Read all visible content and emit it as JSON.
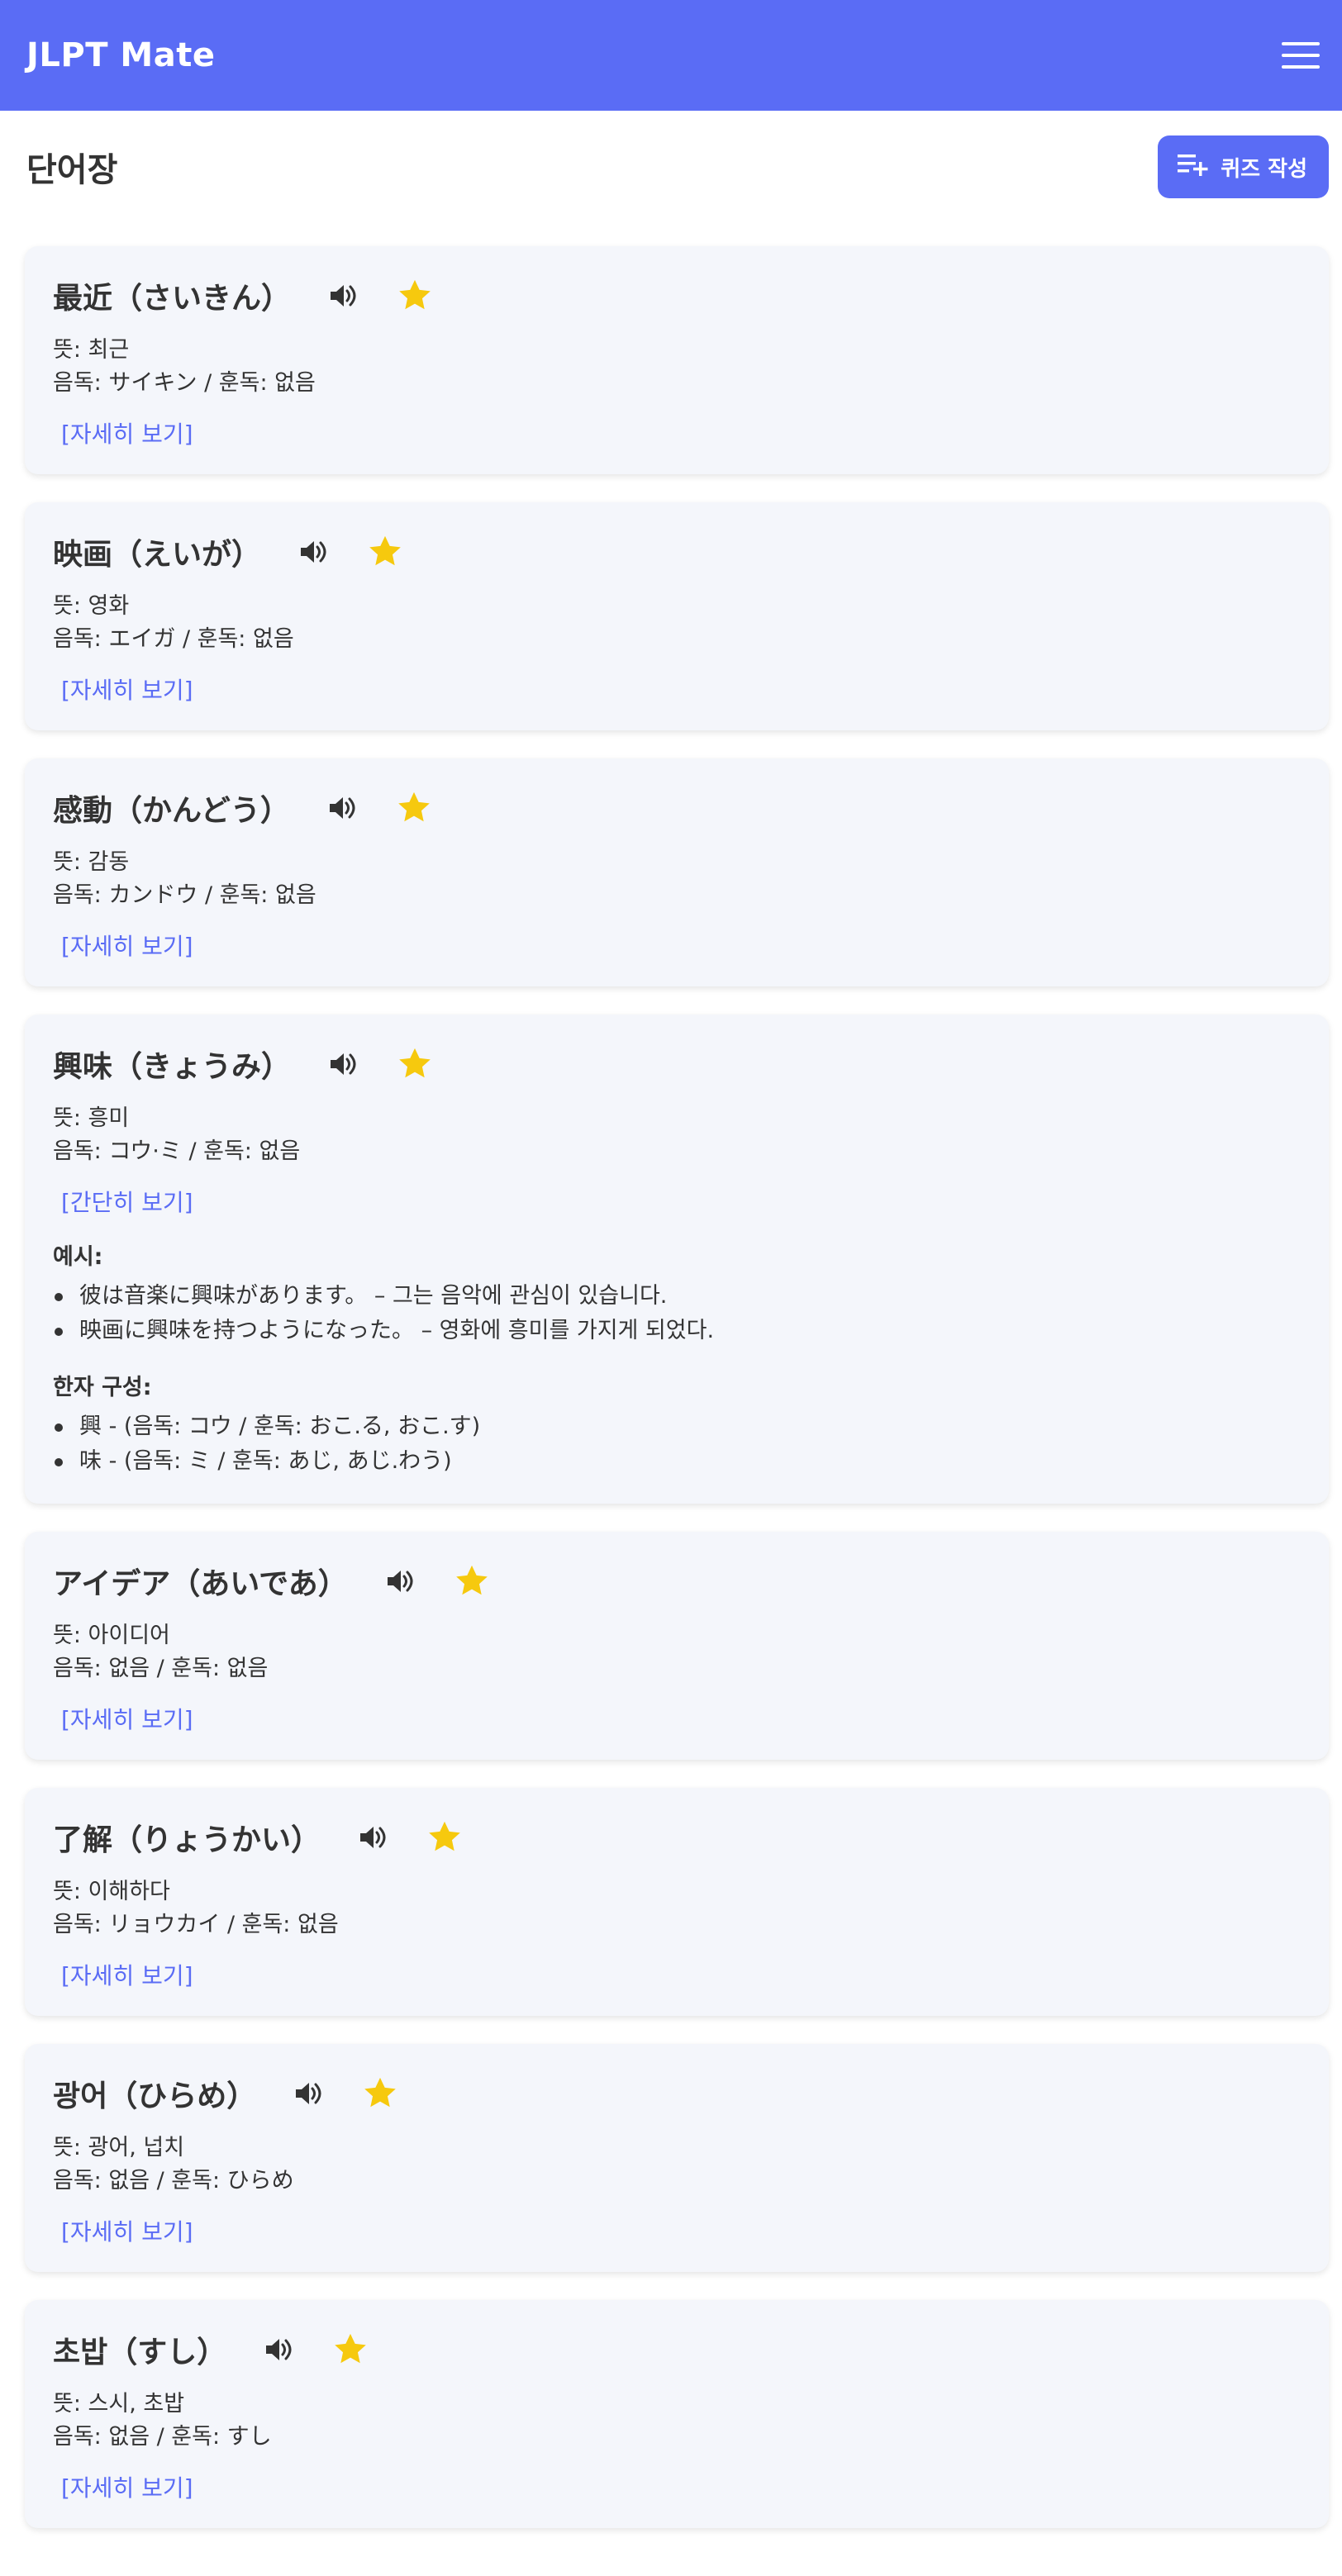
{
  "app": {
    "title": "JLPT Mate"
  },
  "page": {
    "title": "단어장",
    "quiz_button_label": "퀴즈 작성"
  },
  "colors": {
    "brand": "#5a6cf5",
    "star": "#f6c90e",
    "card_bg": "#f4f6fb"
  },
  "icons": {
    "menu": "hamburger-menu-icon",
    "quiz": "playlist-add-icon",
    "speaker": "volume-icon",
    "favorite": "star-icon"
  },
  "words": [
    {
      "word": "最近（さいきん）",
      "meaning": "뜻: 최근",
      "reading": "음독: サイキン / 훈독: 없음",
      "toggle": "[자세히 보기]",
      "expanded": false
    },
    {
      "word": "映画（えいが）",
      "meaning": "뜻: 영화",
      "reading": "음독: エイガ / 훈독: 없음",
      "toggle": "[자세히 보기]",
      "expanded": false
    },
    {
      "word": "感動（かんどう）",
      "meaning": "뜻: 감동",
      "reading": "음독: カンドウ / 훈독: 없음",
      "toggle": "[자세히 보기]",
      "expanded": false
    },
    {
      "word": "興味（きょうみ）",
      "meaning": "뜻: 흥미",
      "reading": "음독: コウ·ミ / 훈독: 없음",
      "toggle": "[간단히 보기]",
      "expanded": true,
      "examples_label": "예시:",
      "examples": [
        "彼は音楽に興味があります。 – 그는 음악에 관심이 있습니다.",
        "映画に興味を持つようになった。 – 영화에 흥미를 가지게 되었다."
      ],
      "kanji_label": "한자 구성:",
      "kanji": [
        "興 - (음독: コウ / 훈독: おこ.る, おこ.す)",
        "味 - (음독: ミ / 훈독: あじ, あじ.わう)"
      ]
    },
    {
      "word": "アイデア（あいであ）",
      "meaning": "뜻: 아이디어",
      "reading": "음독: 없음 / 훈독: 없음",
      "toggle": "[자세히 보기]",
      "expanded": false
    },
    {
      "word": "了解（りょうかい）",
      "meaning": "뜻: 이해하다",
      "reading": "음독: リョウカイ / 훈독: 없음",
      "toggle": "[자세히 보기]",
      "expanded": false
    },
    {
      "word": "광어（ひらめ）",
      "meaning": "뜻: 광어, 넙치",
      "reading": "음독: 없음 / 훈독: ひらめ",
      "toggle": "[자세히 보기]",
      "expanded": false
    },
    {
      "word": "초밥（すし）",
      "meaning": "뜻: 스시, 초밥",
      "reading": "음독: 없음 / 훈독: すし",
      "toggle": "[자세히 보기]",
      "expanded": false
    }
  ]
}
